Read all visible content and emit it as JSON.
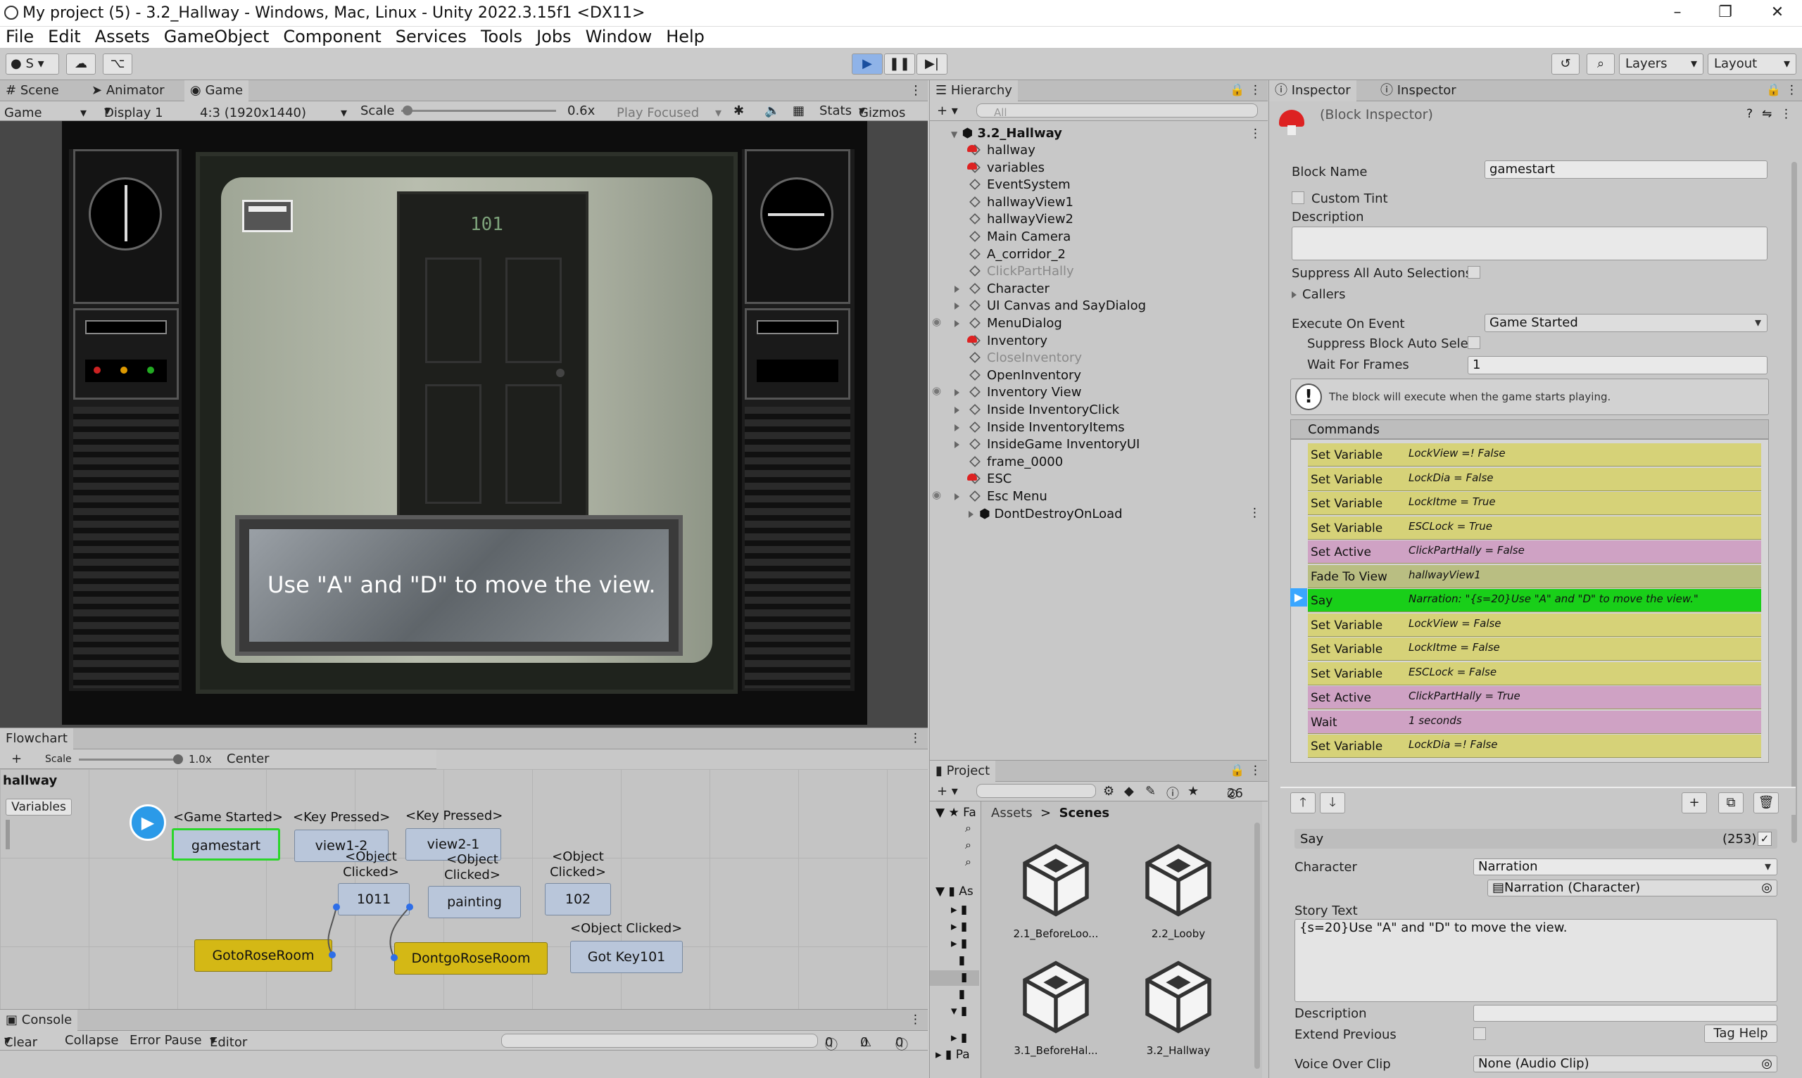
{
  "window": {
    "title": "My project (5) - 3.2_Hallway - Windows, Mac, Linux - Unity 2022.3.15f1 <DX11>"
  },
  "menu": [
    "File",
    "Edit",
    "Assets",
    "GameObject",
    "Component",
    "Services",
    "Tools",
    "Jobs",
    "Window",
    "Help"
  ],
  "toolbar": {
    "account": "S",
    "layers": "Layers",
    "layout": "Layout"
  },
  "game": {
    "tabs": [
      "Scene",
      "Animator",
      "Game"
    ],
    "mode": "Game",
    "display": "Display 1",
    "aspect": "4:3 (1920x1440)",
    "scale_label": "Scale",
    "scale_value": "0.6x",
    "play_focused": "Play Focused",
    "stats": "Stats",
    "gizmos": "Gizmos",
    "door_number": "101",
    "dialog_text": "Use \"A\" and \"D\" to move the view."
  },
  "flowchart": {
    "tab": "Flowchart",
    "scale_label": "Scale",
    "scale_value": "1.0x",
    "center": "Center",
    "name": "hallway",
    "variables": "Variables",
    "events": [
      "<Game Started>",
      "<Key Pressed>",
      "<Key Pressed>",
      "<Object Clicked>",
      "<Object Clicked>",
      "<Object Clicked>",
      "<Object Clicked>"
    ],
    "nodes": [
      "gamestart",
      "view1-2",
      "view2-1",
      "1011",
      "painting",
      "102",
      "GotoRoseRoom",
      "DontgoRoseRoom",
      "Got Key101"
    ]
  },
  "console": {
    "tab": "Console",
    "clear": "Clear",
    "collapse": "Collapse",
    "error_pause": "Error Pause",
    "editor": "Editor",
    "count_info": "0",
    "count_warn": "0",
    "count_err": "0"
  },
  "hierarchy": {
    "tab": "Hierarchy",
    "search_placeholder": "All",
    "scene": "3.2_Hallway",
    "items": [
      "hallway",
      "variables",
      "EventSystem",
      "hallwayView1",
      "hallwayView2",
      "Main Camera",
      "A_corridor_2",
      "ClickPartHally",
      "Character",
      "UI Canvas and SayDialog",
      "MenuDialog",
      "Inventory",
      "CloseInventory",
      "OpenInventory",
      "Inventory View",
      "Inside InventoryClick",
      "Inside InventoryItems",
      "InsideGame InventoryUI",
      "frame_0000",
      "ESC",
      "Esc Menu"
    ],
    "dont_destroy": "DontDestroyOnLoad"
  },
  "project": {
    "tab": "Project",
    "count": "26",
    "breadcrumb_root": "Assets",
    "breadcrumb_current": "Scenes",
    "fav": "Fa",
    "assets_tree": "As",
    "packages": "Pa",
    "assets": [
      "2.1_BeforeLoo...",
      "2.2_Looby",
      "3.1_BeforeHal...",
      "3.2_Hallway"
    ]
  },
  "inspector": {
    "tabs": [
      "Inspector",
      "Inspector"
    ],
    "header": "(Block Inspector)",
    "block_name_label": "Block Name",
    "block_name": "gamestart",
    "custom_tint": "Custom Tint",
    "description": "Description",
    "suppress_all": "Suppress All Auto Selections",
    "callers": "Callers",
    "execute_label": "Execute On Event",
    "execute_value": "Game Started",
    "suppress_block": "Suppress Block Auto Sele",
    "wait_label": "Wait For Frames",
    "wait_value": "1",
    "info": "The block will execute when the game starts playing.",
    "commands_label": "Commands",
    "commands": [
      {
        "name": "Set Variable",
        "summary": "LockView =! False",
        "color": "#d6d278"
      },
      {
        "name": "Set Variable",
        "summary": "LockDia = False",
        "color": "#d6d278"
      },
      {
        "name": "Set Variable",
        "summary": "LockItme = True",
        "color": "#d6d278"
      },
      {
        "name": "Set Variable",
        "summary": "ESCLock = True",
        "color": "#d6d278"
      },
      {
        "name": "Set Active",
        "summary": "ClickPartHally = False",
        "color": "#cfa2c4"
      },
      {
        "name": "Fade To View",
        "summary": "hallwayView1",
        "color": "#b9be82"
      },
      {
        "name": "Say",
        "summary": "Narration: \"{s=20}Use \"A\" and \"D\" to move the view.\"",
        "color": "#19cf19"
      },
      {
        "name": "Set Variable",
        "summary": "LockView = False",
        "color": "#d6d278"
      },
      {
        "name": "Set Variable",
        "summary": "LockItme = False",
        "color": "#d6d278"
      },
      {
        "name": "Set Variable",
        "summary": "ESCLock = False",
        "color": "#d6d278"
      },
      {
        "name": "Set Active",
        "summary": "ClickPartHally = True",
        "color": "#cfa2c4"
      },
      {
        "name": "Wait",
        "summary": "1 seconds",
        "color": "#cfa2c4"
      },
      {
        "name": "Set Variable",
        "summary": "LockDia =! False",
        "color": "#d6d278"
      }
    ],
    "say": {
      "title": "Say",
      "id": "(253)",
      "character_label": "Character",
      "character_value": "Narration",
      "character_obj": "Narration (Character)",
      "story_label": "Story Text",
      "story_text": "{s=20}Use \"A\" and \"D\" to move the view.",
      "description_label": "Description",
      "extend_label": "Extend Previous",
      "tag_help": "Tag Help",
      "voice_label": "Voice Over Clip",
      "voice_value": "None (Audio Clip)"
    }
  }
}
